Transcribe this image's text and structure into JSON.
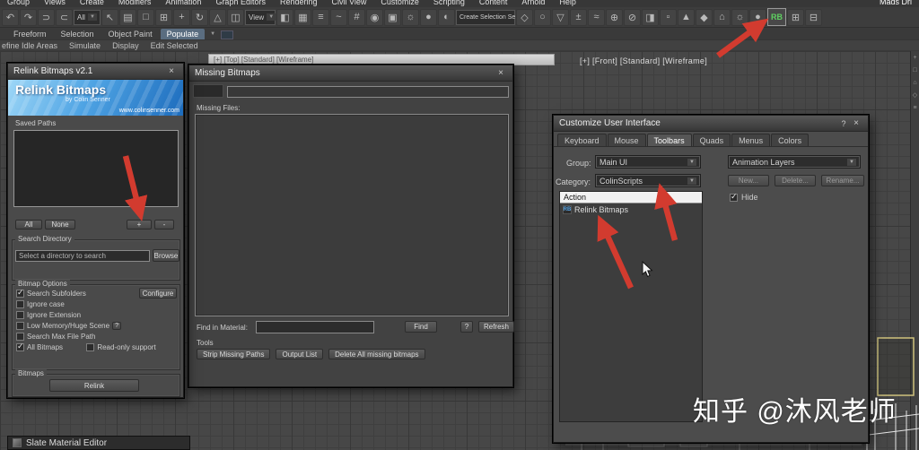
{
  "ui": {
    "close": "×",
    "help": "?",
    "caret": "▼"
  },
  "colors": {
    "accent_red": "#d23b2f",
    "rb_green": "#5fd061",
    "banner_blue": "#2f7fd0"
  },
  "menubar": {
    "items": [
      {
        "label": "Group"
      },
      {
        "label": "Views"
      },
      {
        "label": "Create"
      },
      {
        "label": "Modifiers"
      },
      {
        "label": "Animation"
      },
      {
        "label": "Graph Editors"
      },
      {
        "label": "Rendering"
      },
      {
        "label": "Civil View"
      },
      {
        "label": "Customize"
      },
      {
        "label": "Scripting"
      },
      {
        "label": "Content"
      },
      {
        "label": "Arnold"
      },
      {
        "label": "Help"
      }
    ],
    "user": "Mads Dri"
  },
  "toolbar": {
    "icons_a": [
      {
        "name": "undo-icon",
        "glyph": "↶"
      },
      {
        "name": "redo-icon",
        "glyph": "↷"
      },
      {
        "name": "link-icon",
        "glyph": "⊃"
      },
      {
        "name": "unlink-icon",
        "glyph": "⊂"
      }
    ],
    "filter_value": "All",
    "icons_b": [
      {
        "name": "select-object-icon",
        "glyph": "↖"
      },
      {
        "name": "select-by-name-icon",
        "glyph": "▤"
      },
      {
        "name": "selection-region-icon",
        "glyph": "□"
      },
      {
        "name": "window-crossing-icon",
        "glyph": "⊞"
      },
      {
        "name": "move-icon",
        "glyph": "+"
      },
      {
        "name": "rotate-icon",
        "glyph": "↻"
      },
      {
        "name": "scale-icon",
        "glyph": "△"
      },
      {
        "name": "mirror-icon",
        "glyph": "◫"
      }
    ],
    "view_value": "View",
    "icons_c": [
      {
        "name": "align-icon",
        "glyph": "◧"
      },
      {
        "name": "layer-explorer-icon",
        "glyph": "▦"
      },
      {
        "name": "toolbars-icon",
        "glyph": "≡"
      },
      {
        "name": "curve-editor-icon",
        "glyph": "~"
      },
      {
        "name": "schematic-view-icon",
        "glyph": "#"
      },
      {
        "name": "material-editor-icon",
        "glyph": "◉"
      },
      {
        "name": "render-setup-icon",
        "glyph": "▣"
      },
      {
        "name": "rendered-frame-icon",
        "glyph": "☼"
      },
      {
        "name": "render-production-icon",
        "glyph": "●"
      },
      {
        "name": "shading-icon",
        "glyph": "◐"
      }
    ],
    "selection_set_value": "Create Selection Se",
    "icons_d": [
      {
        "name": "array-icon",
        "glyph": "◇"
      },
      {
        "name": "circle-select-icon",
        "glyph": "○"
      },
      {
        "name": "normal-align-icon",
        "glyph": "▽"
      },
      {
        "name": "spacing-icon",
        "glyph": "±"
      },
      {
        "name": "curves-icon",
        "glyph": "≈"
      },
      {
        "name": "add-mode-icon",
        "glyph": "⊕"
      },
      {
        "name": "exclude-icon",
        "glyph": "⊘"
      },
      {
        "name": "split-view-icon",
        "glyph": "◨"
      },
      {
        "name": "dot-icon",
        "glyph": "▫"
      },
      {
        "name": "pivot-icon",
        "glyph": "▲"
      },
      {
        "name": "gem-icon",
        "glyph": "◆"
      },
      {
        "name": "home-icon",
        "glyph": "⌂"
      },
      {
        "name": "light-icon",
        "glyph": "☼"
      },
      {
        "name": "teapot-render-icon",
        "glyph": "●"
      }
    ],
    "rb_label": "RB",
    "icons_e": [
      {
        "name": "grid-layout-icon",
        "glyph": "⊞"
      },
      {
        "name": "panel-layout-icon",
        "glyph": "⊟"
      }
    ]
  },
  "ribbon": {
    "tabs": [
      {
        "label": "Freeform"
      },
      {
        "label": "Selection"
      },
      {
        "label": "Object Paint"
      },
      {
        "label": "Populate",
        "active": true
      }
    ],
    "panels": [
      {
        "label": "efine Idle Areas"
      },
      {
        "label": "Simulate"
      },
      {
        "label": "Display"
      },
      {
        "label": "Edit Selected"
      }
    ]
  },
  "viewport": {
    "front_label": "[+] [Front] [Standard] [Wireframe]",
    "top_label": "[+] [Top] [Standard] [Wireframe]"
  },
  "relink_dialog": {
    "title": "Relink Bitmaps v2.1",
    "banner": {
      "title": "Relink Bitmaps",
      "subtitle": "by Colin Senner",
      "url": "www.colinsenner.com"
    },
    "saved_paths": {
      "label": "Saved Paths",
      "all": "All",
      "none": "None",
      "add": "+",
      "remove": "-"
    },
    "search_directory": {
      "label": "Search Directory",
      "value": "Select a directory to search",
      "browse": "Browse"
    },
    "bitmap_options": {
      "label": "Bitmap Options",
      "configure": "Configure",
      "checkboxes": [
        {
          "label": "Search Subfolders",
          "checked": true
        },
        {
          "label": "Ignore case"
        },
        {
          "label": "Ignore Extension"
        },
        {
          "label": "Low Memory/Huge Scene",
          "help": "?"
        },
        {
          "label": "Search Max File Path"
        },
        {
          "label": "All Bitmaps",
          "checked": true
        },
        {
          "label": "Read-only support"
        }
      ]
    },
    "bitmaps": {
      "label": "Bitmaps",
      "relink": "Relink"
    }
  },
  "missing_dialog": {
    "title": "Missing Bitmaps",
    "missing_files_label": "Missing Files:",
    "find_in_material_label": "Find in Material:",
    "find_button": "Find",
    "refresh_button": "Refresh",
    "tools_label": "Tools",
    "tool_buttons": [
      {
        "label": "Strip Missing Paths"
      },
      {
        "label": "Output List"
      },
      {
        "label": "Delete All missing bitmaps"
      }
    ]
  },
  "customize_dialog": {
    "title": "Customize User Interface",
    "tabs": [
      {
        "label": "Keyboard"
      },
      {
        "label": "Mouse"
      },
      {
        "label": "Toolbars",
        "active": true
      },
      {
        "label": "Quads"
      },
      {
        "label": "Menus"
      },
      {
        "label": "Colors"
      }
    ],
    "group_label": "Group:",
    "group_value": "Main UI",
    "category_label": "Category:",
    "category_value": "ColinScripts",
    "toolbar_select_value": "Animation Layers",
    "new_button": "New...",
    "delete_button": "Delete...",
    "rename_button": "Rename...",
    "hide_label": "Hide",
    "hide_checked": true,
    "list": {
      "header": "Action",
      "items": [
        {
          "icon": "RB",
          "label": "Relink Bitmaps"
        }
      ]
    }
  },
  "slate": {
    "title": "Slate Material Editor"
  },
  "watermark": {
    "text": "知乎 @沐风老师"
  }
}
